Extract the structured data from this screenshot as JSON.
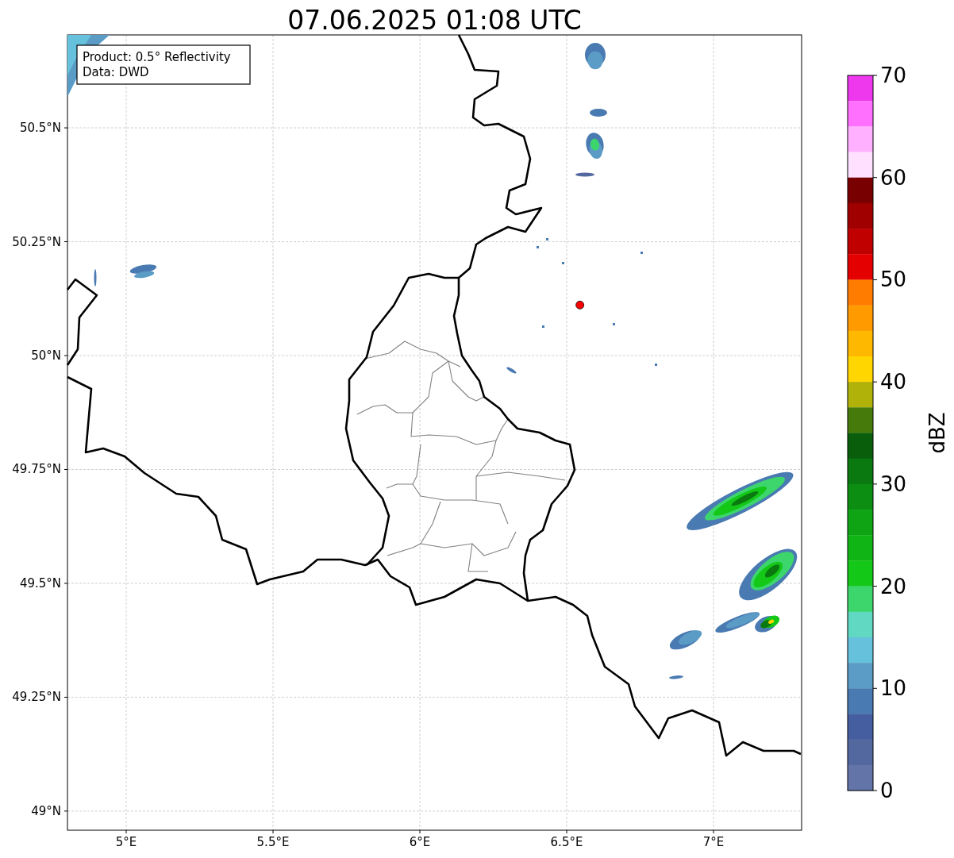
{
  "figure": {
    "map": {
      "chart_data": {
        "type": "scatter",
        "grid": true,
        "title": "07.06.2025 01:08 UTC",
        "xlim": [
          4.8,
          7.3
        ],
        "ylim": [
          48.958,
          50.704
        ],
        "xticks": [
          {
            "value": 5,
            "label": "5°E"
          },
          {
            "value": 5.5,
            "label": "5.5°E"
          },
          {
            "value": 6,
            "label": "6°E"
          },
          {
            "value": 6.5,
            "label": "6.5°E"
          },
          {
            "value": 7,
            "label": "7°E"
          }
        ],
        "yticks": [
          {
            "value": 49,
            "label": "49°N"
          },
          {
            "value": 49.25,
            "label": "49.25°N"
          },
          {
            "value": 49.5,
            "label": "49.5°N"
          },
          {
            "value": 49.75,
            "label": "49.75°N"
          },
          {
            "value": 50,
            "label": "50°N"
          },
          {
            "value": 50.25,
            "label": "50.25°N"
          },
          {
            "value": 50.5,
            "label": "50.5°N"
          }
        ],
        "x": [
          6.545
        ],
        "series": [
          {
            "color": "#ff0000",
            "values": [
              50.111
            ]
          }
        ]
      }
    },
    "info_box": {
      "lines": [
        "Product: 0.5° Reflectivity",
        "Data: DWD"
      ]
    },
    "colorbar": {
      "label": "dBZ",
      "ticks": [
        "70",
        "60",
        "50",
        "40",
        "30",
        "20",
        "10",
        "0"
      ],
      "segments": [
        {
          "color": "#ee38ee"
        },
        {
          "color": "#ff70ff"
        },
        {
          "color": "#ffb0ff"
        },
        {
          "color": "#ffe0ff"
        },
        {
          "color": "#780000"
        },
        {
          "color": "#a00000"
        },
        {
          "color": "#c00000"
        },
        {
          "color": "#e40000"
        },
        {
          "color": "#ff7c00"
        },
        {
          "color": "#ff9a00"
        },
        {
          "color": "#ffb800"
        },
        {
          "color": "#ffd600"
        },
        {
          "color": "#b0b20a"
        },
        {
          "color": "#467a0a"
        },
        {
          "color": "#085e0a"
        },
        {
          "color": "#0a7a10"
        },
        {
          "color": "#0c8e12"
        },
        {
          "color": "#0fa414"
        },
        {
          "color": "#10b414"
        },
        {
          "color": "#14c818"
        },
        {
          "color": "#3dd66c"
        },
        {
          "color": "#60d8c2"
        },
        {
          "color": "#66c2dc"
        },
        {
          "color": "#5b9cc6"
        },
        {
          "color": "#4a7ab2"
        },
        {
          "color": "#445ea0"
        },
        {
          "color": "#5468a0"
        },
        {
          "color": "#6374a8"
        }
      ]
    }
  }
}
